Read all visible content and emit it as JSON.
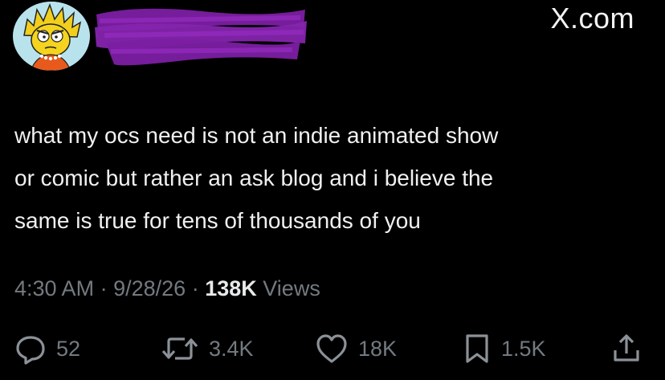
{
  "header": {
    "site_label": "X.com"
  },
  "tweet": {
    "lines": [
      "what my ocs need is not an indie animated show",
      "or comic but rather an ask blog and i believe the",
      "same is true for tens of thousands of you"
    ],
    "time": "4:30 AM",
    "date": "9/28/26",
    "separator": "·",
    "views_count": "138K",
    "views_label": "Views"
  },
  "actions": {
    "replies": "52",
    "reposts": "3.4K",
    "likes": "18K",
    "bookmarks": "1.5K"
  },
  "colors": {
    "background": "#000000",
    "text": "#f0f0f0",
    "muted": "#737a80",
    "redaction": "#7b1fa2"
  },
  "icons": {
    "reply": "speech-bubble-icon",
    "repost": "repost-arrows-icon",
    "like": "heart-icon",
    "bookmark": "bookmark-icon",
    "share": "share-upload-icon"
  }
}
